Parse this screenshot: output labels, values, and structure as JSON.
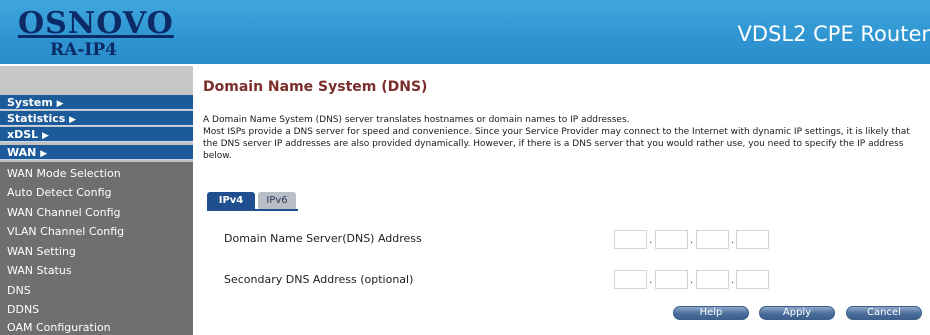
{
  "header": {
    "logo_main": "OSNOVO",
    "logo_sub": "RA-IP4",
    "product": "VDSL2 CPE Router"
  },
  "nav": {
    "categories": [
      {
        "label": "System",
        "arrow": "▶"
      },
      {
        "label": "Statistics",
        "arrow": "▶"
      },
      {
        "label": "xDSL",
        "arrow": "▶"
      },
      {
        "label": "WAN",
        "arrow": "▶"
      }
    ],
    "wan_items": [
      "WAN Mode Selection",
      "Auto Detect Config",
      "WAN Channel Config",
      "VLAN Channel Config",
      "WAN Setting",
      "WAN Status",
      "DNS",
      "DDNS",
      "OAM Configuration"
    ]
  },
  "page": {
    "title": "Domain Name System (DNS)",
    "desc1": "A Domain Name System (DNS) server translates hostnames or domain names to IP addresses.",
    "desc2": "Most ISPs provide a DNS server for speed and convenience. Since your Service Provider may connect to the Internet with dynamic IP settings, it is likely that the DNS server IP addresses are also provided dynamically. However, if there is a DNS server that you would rather use, you need to specify the IP address below."
  },
  "tabs": {
    "ipv4": "IPv4",
    "ipv6": "IPv6",
    "active": "IPv4"
  },
  "form": {
    "primary_label": "Domain Name Server(DNS) Address",
    "secondary_label": "Secondary DNS Address (optional)",
    "primary_octets": [
      "",
      "",
      "",
      ""
    ],
    "secondary_octets": [
      "",
      "",
      "",
      ""
    ],
    "separator": "."
  },
  "buttons": {
    "help": "Help",
    "apply": "Apply",
    "cancel": "Cancel"
  }
}
